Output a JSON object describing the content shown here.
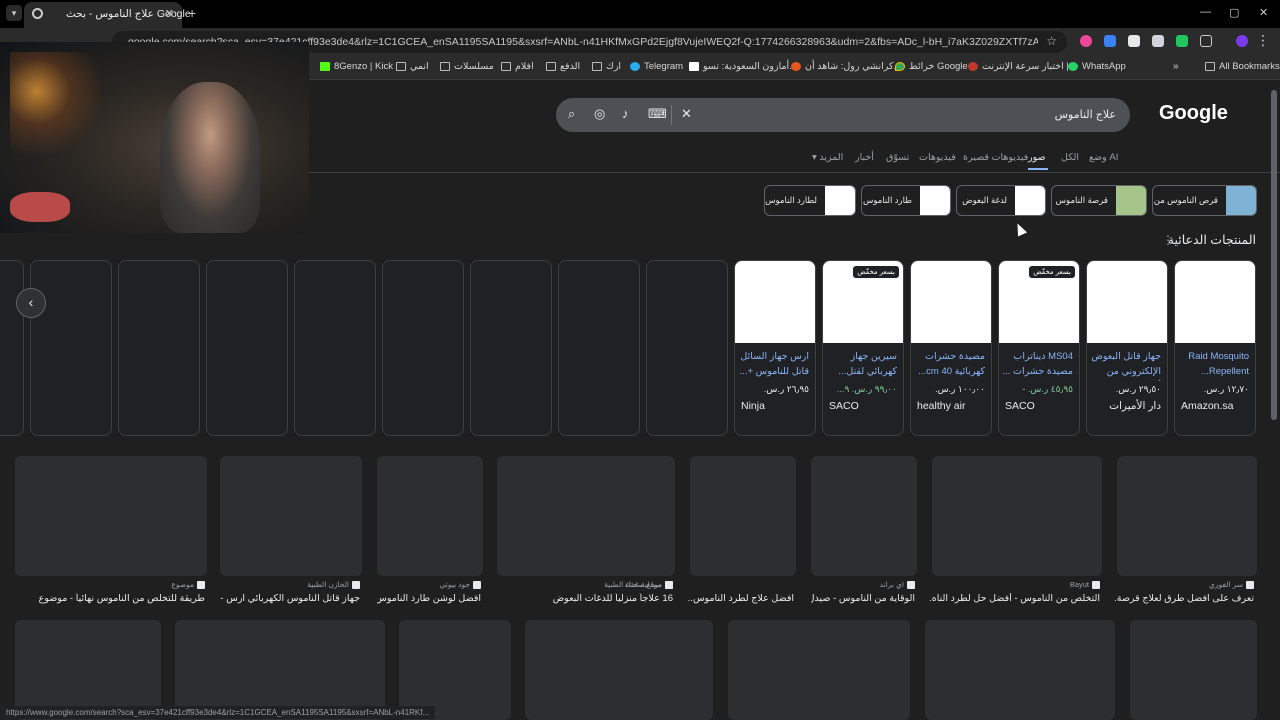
{
  "browser": {
    "tab_title": "علاج الناموس - بحث Google",
    "url": "google.com/search?sca_esv=37e421cff93e3de4&rlz=1C1GCEA_enSA1195SA1195&sxsrf=ANbL-n41HKfMxGPd2Ejgf8VujeIWEQ2f-Q:1774266328963&udm=2&fbs=ADc_l-bH_i7aK3Z029ZXTf7zAL4HBtagbdVEtjxO794v61W...",
    "status_url": "https://www.google.com/search?sca_esv=37e421cff93e3de4&rlz=1C1GCEA_enSA1195SA1195&sxsrf=ANbL-n41RKf..."
  },
  "bookmarks": [
    {
      "label": "8Genzo | Kick",
      "icon": "kick-icon"
    },
    {
      "label": "انمي",
      "icon": "folder-icon"
    },
    {
      "label": "مسلسلات",
      "icon": "folder-icon"
    },
    {
      "label": "افلام",
      "icon": "folder-icon"
    },
    {
      "label": "الدفع",
      "icon": "folder-icon"
    },
    {
      "label": "ارك",
      "icon": "folder-icon"
    },
    {
      "label": "Telegram",
      "icon": "telegram-icon"
    },
    {
      "label": "أمازون السعودية: تسو...",
      "icon": "amazon-icon"
    },
    {
      "label": "كرانشي رول: شاهد أن...",
      "icon": "crunchyroll-icon"
    },
    {
      "label": "خرائط Google",
      "icon": "maps-icon"
    },
    {
      "label": "اختبار سرعة الإنترنت |...",
      "icon": "speedtest-icon"
    },
    {
      "label": "WhatsApp",
      "icon": "whatsapp-icon"
    }
  ],
  "all_bookmarks_label": "All Bookmarks",
  "search": {
    "logo": "Google",
    "query": "علاج الناموس"
  },
  "nav_tabs": [
    {
      "label": "وضع AI",
      "active": false
    },
    {
      "label": "الكل",
      "active": false
    },
    {
      "label": "صور",
      "active": true
    },
    {
      "label": "فيديوهات قصيرة",
      "active": false
    },
    {
      "label": "فيديوهات",
      "active": false
    },
    {
      "label": "تسوّق",
      "active": false
    },
    {
      "label": "أخبار",
      "active": false
    },
    {
      "label": "المزيد",
      "active": false
    }
  ],
  "chips": [
    "قرص الناموس من",
    "قرصة الناموس",
    "لدغة البعوض",
    "طارد الناموس",
    "لطارد الناموس"
  ],
  "sponsored_title": "المنتجات الدعائية",
  "products": [
    {
      "name": "Raid Mosquito Repellent...",
      "price": "١٢٫٧٠ ر.س.",
      "seller": "Amazon.sa",
      "badge": "",
      "sale": false
    },
    {
      "name": "جهاز قاتل البعوض الإلكتروني من أر...",
      "price": "٢٩٫٥٠ ر.س.",
      "seller": "دار الأميرات",
      "badge": "",
      "sale": false
    },
    {
      "name": "MS04 ديناتراب مصيدة حشرات ...",
      "price": "٤٥٫٩٥ ر.س. -",
      "seller": "SACO",
      "badge": "بسعر مخفّض",
      "sale": true
    },
    {
      "name": "مصيدة حشرات كهربائية 40 cm...",
      "price": "١٠٠٫٠٠ ر.س.",
      "seller": "healthy air",
      "badge": "",
      "sale": false
    },
    {
      "name": "سيرين جهاز كهربائي لقتل...",
      "price": "٩٩٫٠٠ ر.س. ٩...",
      "seller": "SACO",
      "badge": "بسعر مخفّض",
      "sale": true
    },
    {
      "name": "ارس جهاز السائل قاتل للناموس +...",
      "price": "٢٦٫٩٥ ر.س.",
      "seller": "Ninja",
      "badge": "",
      "sale": false
    }
  ],
  "results_row1": [
    {
      "source": "سر الفوري",
      "caption": "تعرف على افضل طرق لعلاج قرصة..."
    },
    {
      "source": "Bayut",
      "caption": "التخلص من الناموس - أفضل حل لطرد الناه..."
    },
    {
      "source": "اي براند",
      "caption": "الوقاية من الناموس - صيدل..."
    },
    {
      "source": "صيدلية غذاء الطبية",
      "caption": "افضل علاج لطرد الناموس..."
    },
    {
      "source": "موقع صحتك",
      "caption": "16 علاجاً منزلياً للدغات البعوض"
    },
    {
      "source": "جود بيوتي",
      "caption": "افضل لوشن طارد الناموس ..."
    },
    {
      "source": "الخازن الطبية",
      "caption": "جهاز قاتل الناموس الكهربائي ارس - ..."
    },
    {
      "source": "موضوع",
      "caption": "طريقة للتخلص من الناموس نهائياً - موضوع"
    }
  ]
}
